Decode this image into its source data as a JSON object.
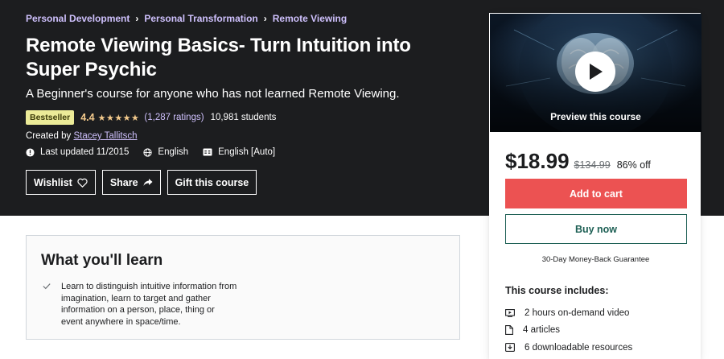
{
  "breadcrumb": [
    "Personal Development",
    "Personal Transformation",
    "Remote Viewing"
  ],
  "course": {
    "title": "Remote Viewing Basics- Turn Intuition into Super Psychic",
    "subtitle": "A Beginner's course for anyone who has not learned Remote Viewing.",
    "badge": "Bestseller",
    "rating": "4.4",
    "stars_value": 4.4,
    "stars": "★★★★★",
    "ratings_count": "(1,287 ratings)",
    "students": "10,981 students",
    "created_by_label": "Created by",
    "instructor": "Stacey Tallitsch",
    "last_updated": "Last updated 11/2015",
    "language": "English",
    "captions": "English [Auto]"
  },
  "actions": {
    "wishlist": "Wishlist",
    "share": "Share",
    "gift": "Gift this course"
  },
  "sidebar": {
    "preview_label": "Preview this course",
    "price": "$18.99",
    "original_price": "$134.99",
    "discount": "86% off",
    "add_to_cart": "Add to cart",
    "buy_now": "Buy now",
    "guarantee": "30-Day Money-Back Guarantee",
    "includes_title": "This course includes:",
    "includes": [
      {
        "icon": "video-icon",
        "label": "2 hours on-demand video"
      },
      {
        "icon": "file-icon",
        "label": "4 articles"
      },
      {
        "icon": "download-icon",
        "label": "6 downloadable resources"
      }
    ]
  },
  "learn": {
    "title": "What you'll learn",
    "items": [
      "Learn to distinguish intuitive information from imagination, learn to target and gather information on a person, place, thing or event anywhere in space/time."
    ]
  },
  "colors": {
    "hero_bg": "#1c1d1f",
    "link": "#cec0fc",
    "star": "#f3ca8c",
    "cart": "#ec5252",
    "buy": "#1e6055",
    "badge_bg": "#eceb98"
  }
}
